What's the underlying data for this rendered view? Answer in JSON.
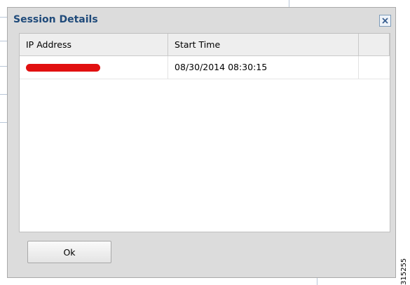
{
  "dialog": {
    "title": "Session Details",
    "close_label": "Close",
    "ok_label": "Ok"
  },
  "table": {
    "columns": [
      "IP Address",
      "Start Time",
      ""
    ],
    "rows": [
      {
        "ip_address": "",
        "start_time": "08/30/2014 08:30:15",
        "redacted": true
      }
    ]
  },
  "figure_id": "315255",
  "colors": {
    "title": "#1f4a7a",
    "redaction": "#e11010",
    "dialog_bg": "#dcdcdc"
  },
  "icons": {
    "close": "close-icon"
  }
}
